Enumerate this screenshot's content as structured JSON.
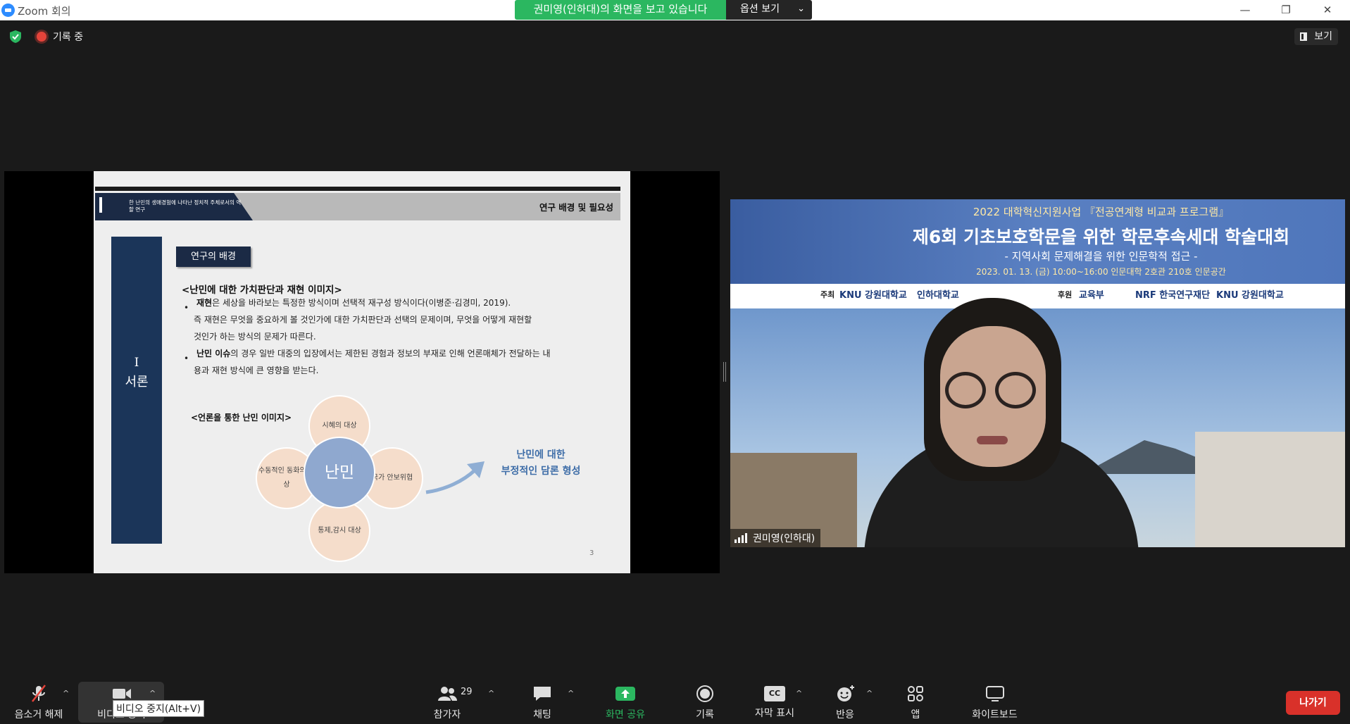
{
  "window": {
    "title": "Zoom 회의",
    "minimize": "—",
    "restore": "❐",
    "close": "✕"
  },
  "share_banner": {
    "message": "권미영(인하대)의 화면을 보고 있습니다",
    "options_label": "옵션 보기",
    "options_chevron": "⌄"
  },
  "status": {
    "recording_label": "기록 중",
    "view_label": "보기",
    "security_color": "#2bb760",
    "recording_color": "#e5433a"
  },
  "slide": {
    "header_left": "한 난민의 생애경험에 나타난 정치적 주체로서의 역할 연구",
    "header_right": "연구 배경 및 필요성",
    "sidebar_roman": "I",
    "sidebar_label": "서론",
    "section_label": "연구의 배경",
    "subheading": "<난민에 대한 가치판단과 재현 이미지>",
    "bullets": [
      {
        "mark": "•",
        "bold": "재현",
        "line1": "은 세상을 바라보는 특정한 방식이며 선택적 재구성 방식이다(이병준·김경미, 2019).",
        "line2": "즉 재현은 무엇을 중요하게 볼 것인가에 대한 가치판단과 선택의 문제이며, 무엇을 어떻게 재현할",
        "line3": "것인가 하는 방식의 문제가 따른다."
      },
      {
        "mark": "•",
        "bold": "난민 이슈",
        "line1": "의 경우 일반 대중의 입장에서는 제한된 경험과 정보의 부재로 인해 언론매체가 전달하는 내",
        "line2": "용과 재현 방식에 큰 영향을 받는다."
      }
    ],
    "image_heading": "<언론을 통한 난민 이미지>",
    "center": "난민",
    "petals": {
      "top": "시혜의 대상",
      "right": "국가 안보위협",
      "bottom": "통제,감시 대상",
      "left": "수동적인 동화의 대상"
    },
    "result_line1": "난민에 대한",
    "result_line2": "부정적인 담론 형성",
    "page_number": "3",
    "accent_color": "#1b3559"
  },
  "video": {
    "banner_line1": "2022 대학혁신지원사업 『전공연계형 비교과 프로그램』",
    "banner_line2": "제6회 기초보호학문을 위한 학문후속세대 학술대회",
    "banner_line3": "- 지역사회 문제해결을 위한 인문학적 접근 -",
    "banner_line4": "2023. 01. 13. (금) 10:00~16:00 인문대학 2호관 210호 인문공간",
    "host_label": "주최",
    "host_org": "KNU 강원대학교",
    "host_org2": "인하대학교",
    "sponsor_label": "후원",
    "sponsor_orgs": [
      "교육부",
      "NRF 한국연구재단",
      "KNU 강원대학교"
    ],
    "participant_name": "권미영(인하대)"
  },
  "toolbar": {
    "unmute_label": "음소거 해제",
    "video_label": "비디오 중지",
    "video_tooltip": "비디오 중지(Alt+V)",
    "participants_label": "참가자",
    "participants_count": "29",
    "chat_label": "채팅",
    "share_label": "화면 공유",
    "record_label": "기록",
    "cc_label": "자막 표시",
    "cc_icon_text": "CC",
    "reactions_label": "반응",
    "apps_label": "앱",
    "whiteboard_label": "화이트보드",
    "leave_label": "나가기",
    "caret": "^",
    "share_color": "#2bb760",
    "leave_color": "#d9312a"
  }
}
